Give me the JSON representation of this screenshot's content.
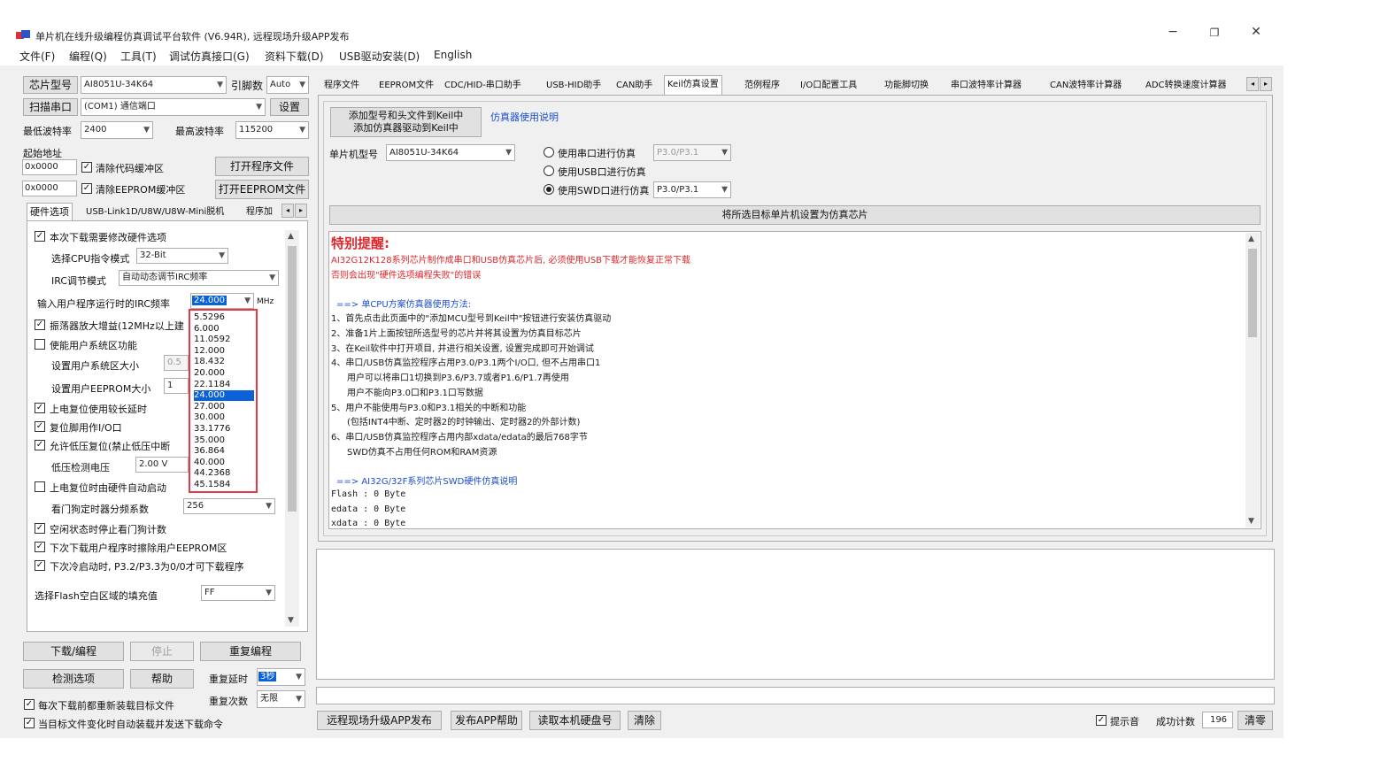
{
  "window": {
    "title": "单片机在线升级编程仿真调试平台软件 (V6.94R), 远程现场升级APP发布",
    "minimize": "−",
    "restore": "❐",
    "close": "✕"
  },
  "menu": [
    "文件(F)",
    "编程(Q)",
    "工具(T)",
    "调试仿真接口(G)",
    "资料下载(D)",
    "USB驱动安装(D)",
    "English"
  ],
  "left": {
    "chip_model_btn": "芯片型号",
    "chip_model_value": "AI8051U-34K64",
    "pin_label": "引脚数",
    "pin_value": "Auto",
    "scan_port_btn": "扫描串口",
    "port_value": "(COM1) 通信端口",
    "settings_btn": "设置",
    "min_baud_label": "最低波特率",
    "min_baud_value": "2400",
    "max_baud_label": "最高波特率",
    "max_baud_value": "115200",
    "start_addr_label": "起始地址",
    "addr1": "0x0000",
    "clear_code_label": "清除代码缓冲区",
    "open_prog_btn": "打开程序文件",
    "addr2": "0x0000",
    "clear_eeprom_label": "清除EEPROM缓冲区",
    "open_eeprom_btn": "打开EEPROM文件",
    "tabs": [
      "硬件选项",
      "USB-Link1D/U8W/U8W-Mini脱机",
      "程序加"
    ],
    "hw": {
      "opt1": "本次下载需要修改硬件选项",
      "cpu_mode_label": "选择CPU指令模式",
      "cpu_mode_value": "32-Bit",
      "irc_mode_label": "IRC调节模式",
      "irc_mode_value": "自动动态调节IRC频率",
      "irc_freq_label": "输入用户程序运行时的IRC频率",
      "irc_freq_value": "24.000",
      "irc_unit": "MHz",
      "opt2": "振荡器放大增益(12MHz以上建",
      "opt3": "使能用户系统区功能",
      "sys_size_label": "设置用户系统区大小",
      "sys_size_value": "0.5",
      "eeprom_size_label": "设置用户EEPROM大小",
      "eeprom_size_value": "1",
      "opt4": "上电复位使用较长延时",
      "opt5": "复位脚用作I/O口",
      "opt6": "允许低压复位(禁止低压中断",
      "lv_label": "低压检测电压",
      "lv_value": "2.00 V",
      "opt7": "上电复位时由硬件自动启动",
      "wdt_label": "看门狗定时器分频系数",
      "wdt_value": "256",
      "opt8": "空闲状态时停止看门狗计数",
      "opt9": "下次下载用户程序时擦除用户EEPROM区",
      "opt10": "下次冷启动时, P3.2/P3.3为0/0才可下载程序",
      "fill_label": "选择Flash空白区域的填充值",
      "fill_value": "FF"
    },
    "freq_options": [
      "5.5296",
      "6.000",
      "11.0592",
      "12.000",
      "18.432",
      "20.000",
      "22.1184",
      "24.000",
      "27.000",
      "30.000",
      "33.1776",
      "35.000",
      "36.864",
      "40.000",
      "44.2368",
      "45.1584"
    ],
    "freq_selected_index": 7,
    "download_btn": "下载/编程",
    "stop_btn": "停止",
    "reprogram_btn": "重复编程",
    "check_btn": "检测选项",
    "help_btn": "帮助",
    "repeat_delay_label": "重复延时",
    "repeat_delay_value": "3秒",
    "repeat_count_label": "重复次数",
    "repeat_count_value": "无限",
    "reload_label": "每次下载前都重新装载目标文件",
    "auto_send_label": "当目标文件变化时自动装载并发送下载命令"
  },
  "right": {
    "tabs": [
      "程序文件",
      "EEPROM文件",
      "CDC/HID-串口助手",
      "USB-HID助手",
      "CAN助手",
      "Keil仿真设置",
      "范例程序",
      "I/O口配置工具",
      "功能脚切换",
      "串口波特率计算器",
      "CAN波特率计算器",
      "ADC转换速度计算器"
    ],
    "active_tab_index": 5,
    "add_btn_line1": "添加型号和头文件到Keil中",
    "add_btn_line2": "添加仿真器驱动到Keil中",
    "sim_help_link": "仿真器使用说明",
    "mcu_label": "单片机型号",
    "mcu_value": "AI8051U-34K64",
    "radio1": "使用串口进行仿真",
    "radio1_value": "P3.0/P3.1",
    "radio2": "使用USB口进行仿真",
    "radio3": "使用SWD口进行仿真",
    "radio3_value": "P3.0/P3.1",
    "set_target_btn": "将所选目标单片机设置为仿真芯片",
    "info_title": "特别提醒:",
    "info_red1": "AI32G12K128系列芯片制作成串口和USB仿真芯片后, 必须使用USB下载才能恢复正常下载",
    "info_red2": "否则会出现\"硬件选项编程失败\"的错误",
    "info_blue1": "==> 单CPU方案仿真器使用方法:",
    "info_l1": "1、首先点击此页面中的\"添加MCU型号到Keil中\"按钮进行安装仿真驱动",
    "info_l2": "2、准备1片上面按钮所选型号的芯片并将其设置为仿真目标芯片",
    "info_l3": "3、在Keil软件中打开项目, 并进行相关设置, 设置完成即可开始调试",
    "info_l4": "4、串口/USB仿真监控程序占用P3.0/P3.1两个I/O口, 但不占用串口1",
    "info_l4a": "用户可以将串口1切换到P3.6/P3.7或者P1.6/P1.7再使用",
    "info_l4b": "用户不能向P3.0口和P3.1口写数据",
    "info_l5": "5、用户不能使用与P3.0和P3.1相关的中断和功能",
    "info_l5a": "(包括INT4中断、定时器2的时钟输出、定时器2的外部计数)",
    "info_l6": "6、串口/USB仿真监控程序占用内部xdata/edata的最后768字节",
    "info_l6a": "SWD仿真不占用任何ROM和RAM资源",
    "info_blue2": "==> AI32G/32F系列芯片SWD硬件仿真说明",
    "info_f1": "Flash : 0 Byte",
    "info_f2": "edata : 0 Byte",
    "info_f3": "xdata : 0 Byte",
    "bottom_btn1": "远程现场升级APP发布",
    "bottom_btn2": "发布APP帮助",
    "bottom_btn3": "读取本机硬盘号",
    "bottom_btn4": "清除",
    "tip_sound_label": "提示音",
    "success_label": "成功计数",
    "success_value": "196",
    "clear_count_btn": "清零"
  }
}
